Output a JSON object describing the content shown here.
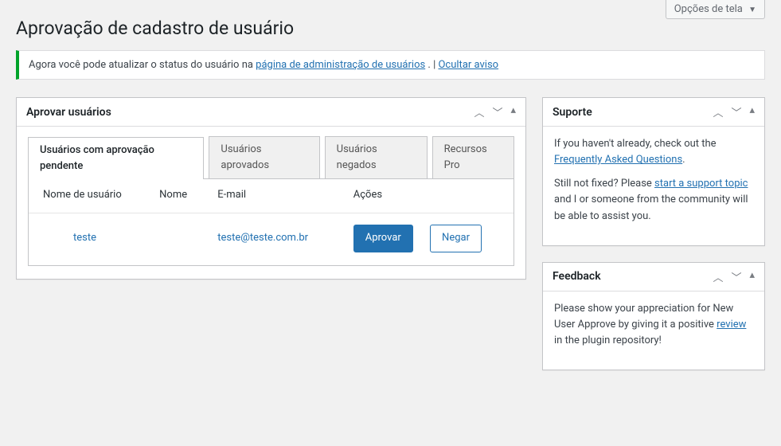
{
  "screen_options": {
    "label": "Opções de tela"
  },
  "page_title": "Aprovação de cadastro de usuário",
  "notice": {
    "text1": "Agora você pode atualizar o status do usuário na ",
    "link1": "página de administração de usuários",
    "separator": ". | ",
    "link2": "Ocultar aviso"
  },
  "approve_box": {
    "title": "Aprovar usuários",
    "tabs": [
      {
        "label": "Usuários com aprovação pendente"
      },
      {
        "label": "Usuários aprovados"
      },
      {
        "label": "Usuários negados"
      },
      {
        "label": "Recursos Pro"
      }
    ],
    "columns": {
      "username": "Nome de usuário",
      "name": "Nome",
      "email": "E-mail",
      "actions": "Ações"
    },
    "rows": [
      {
        "username": "teste",
        "name": "",
        "email": "teste@teste.com.br",
        "approve_label": "Aprovar",
        "deny_label": "Negar"
      }
    ]
  },
  "support_box": {
    "title": "Suporte",
    "p1_a": "If you haven't already, check out the ",
    "p1_link": "Frequently Asked Questions",
    "p1_b": ".",
    "p2_a": "Still not fixed? Please ",
    "p2_link": "start a support topic",
    "p2_b": " and I or someone from the community will be able to assist you."
  },
  "feedback_box": {
    "title": "Feedback",
    "p1_a": "Please show your appreciation for New User Approve by giving it a positive ",
    "p1_link": "review",
    "p1_b": " in the plugin repository!"
  }
}
